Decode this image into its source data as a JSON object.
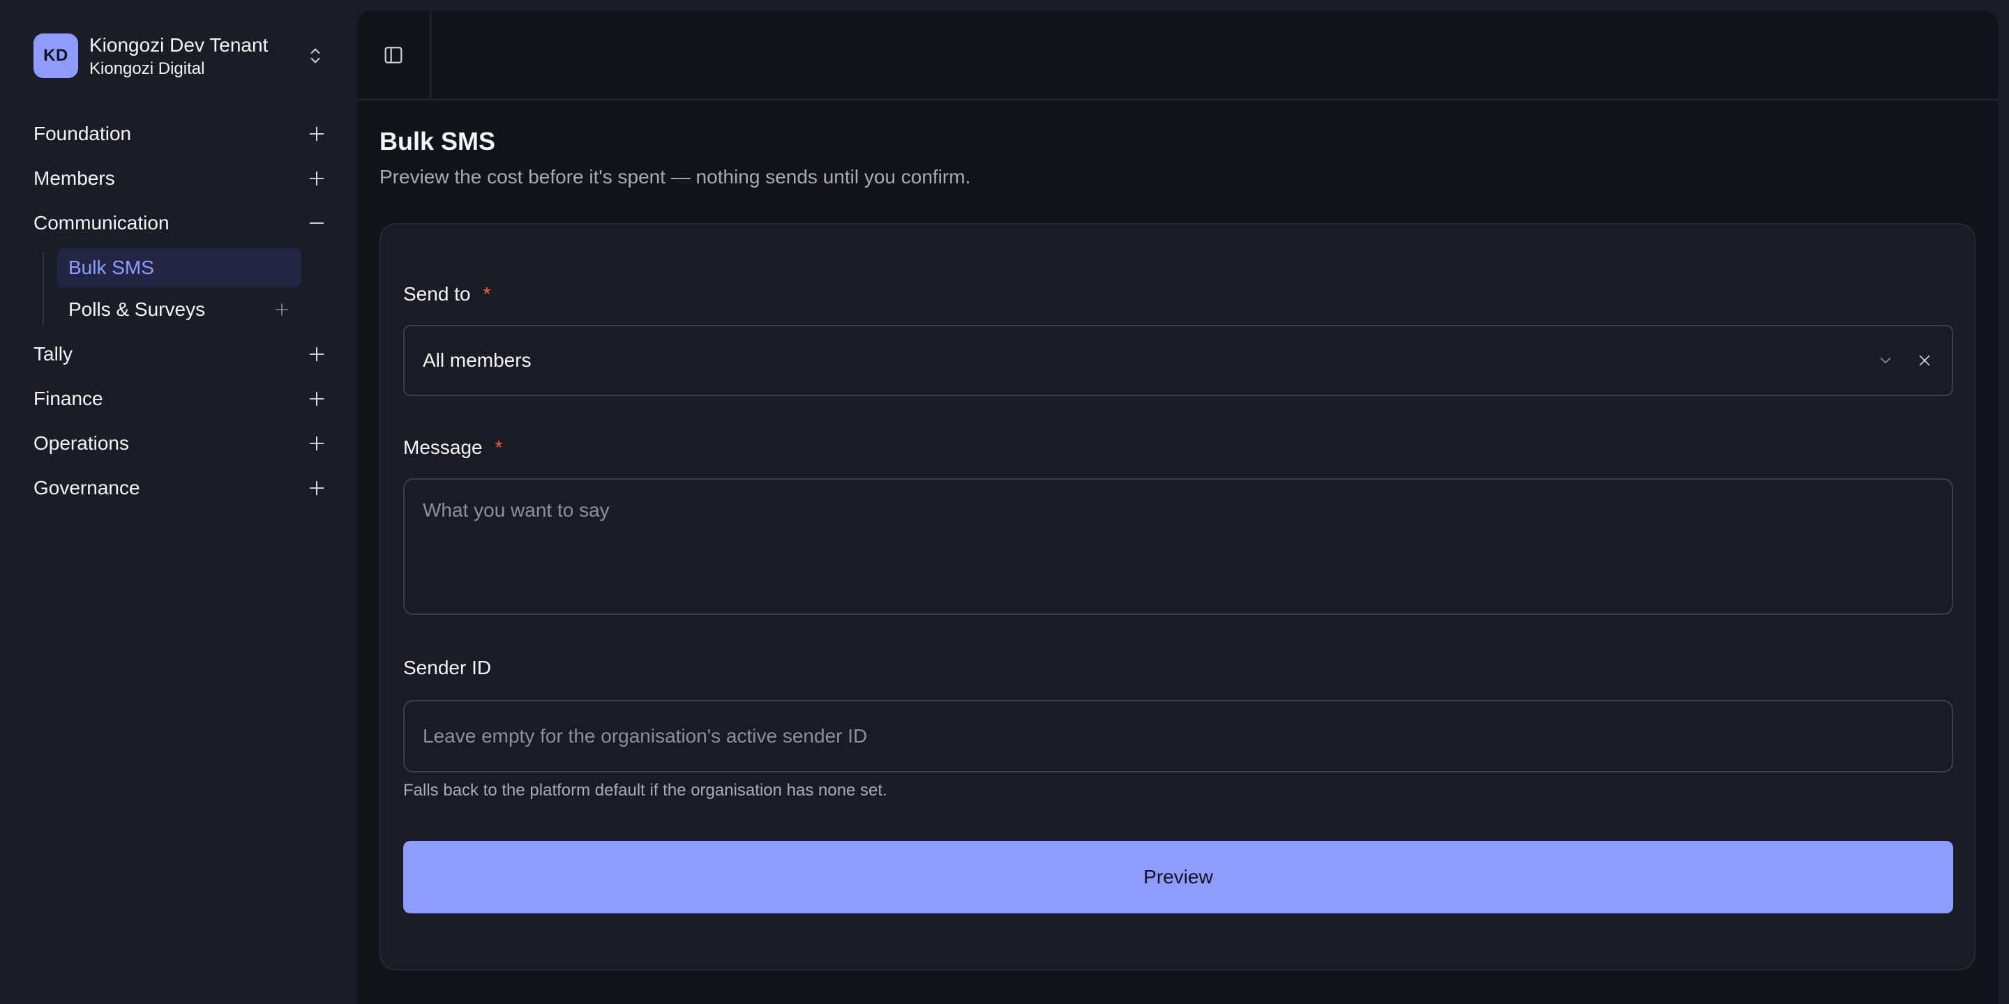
{
  "tenant": {
    "initials": "KD",
    "name": "Kiongozi Dev Tenant",
    "organisation": "Kiongozi Digital"
  },
  "sidebar": {
    "items": [
      {
        "label": "Foundation",
        "expanded": false
      },
      {
        "label": "Members",
        "expanded": false
      },
      {
        "label": "Communication",
        "expanded": true,
        "children": [
          {
            "label": "Bulk SMS",
            "active": true
          },
          {
            "label": "Polls & Surveys",
            "active": false
          }
        ]
      },
      {
        "label": "Tally",
        "expanded": false
      },
      {
        "label": "Finance",
        "expanded": false
      },
      {
        "label": "Operations",
        "expanded": false
      },
      {
        "label": "Governance",
        "expanded": false
      }
    ]
  },
  "page": {
    "title": "Bulk SMS",
    "subtitle": "Preview the cost before it's spent — nothing sends until you confirm."
  },
  "form": {
    "send_to": {
      "label": "Send to",
      "required_mark": "*",
      "value": "All members"
    },
    "message": {
      "label": "Message",
      "required_mark": "*",
      "placeholder": "What you want to say"
    },
    "sender_id": {
      "label": "Sender ID",
      "placeholder": "Leave empty for the organisation's active sender ID",
      "hint": "Falls back to the platform default if the organisation has none set."
    },
    "preview_label": "Preview"
  },
  "colors": {
    "accent": "#8f9cff",
    "required": "#ff5a3c",
    "background": "#1a1d25",
    "panel": "#121419"
  },
  "icons": {
    "tenant_switcher": "chevron-up-down-icon",
    "collapsed": "plus-icon",
    "expanded": "minus-icon",
    "sidebar_toggle": "sidebar-toggle-icon",
    "select_open": "chevron-down-icon",
    "select_clear": "close-icon"
  }
}
